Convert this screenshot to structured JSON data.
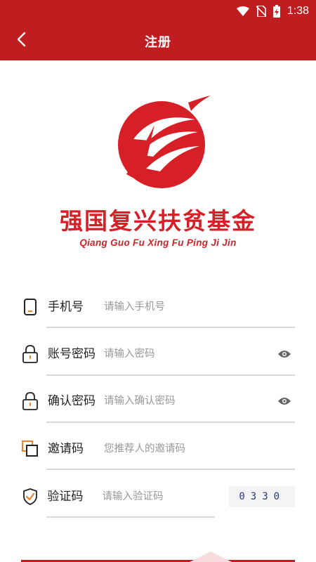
{
  "status_bar": {
    "time": "1:38",
    "icons": [
      "wifi-icon",
      "no-sim-icon",
      "battery-charging-icon"
    ]
  },
  "header": {
    "title": "注册",
    "back_icon": "chevron-left-icon"
  },
  "brand": {
    "name_cn": "强国复兴扶贫基金",
    "name_en": "Qiang Guo Fu Xing Fu Ping Ji Jin",
    "color": "#d61f26"
  },
  "form": {
    "fields": [
      {
        "label": "手机号",
        "placeholder": "请输入手机号",
        "icon": "phone-icon"
      },
      {
        "label": "账号密码",
        "placeholder": "请输入密码",
        "icon": "lock-icon",
        "trailing_icon": "eye-icon"
      },
      {
        "label": "确认密码",
        "placeholder": "请输入确认密码",
        "icon": "lock-icon",
        "trailing_icon": "eye-icon"
      },
      {
        "label": "邀请码",
        "placeholder": "您推荐人的邀请码",
        "icon": "copy-icon"
      },
      {
        "label": "验证码",
        "placeholder": "请输入验证码",
        "icon": "shield-check-icon",
        "captcha": "0330"
      }
    ]
  },
  "colors": {
    "primary": "#bf1d20",
    "accent_orange": "#e8852c"
  }
}
